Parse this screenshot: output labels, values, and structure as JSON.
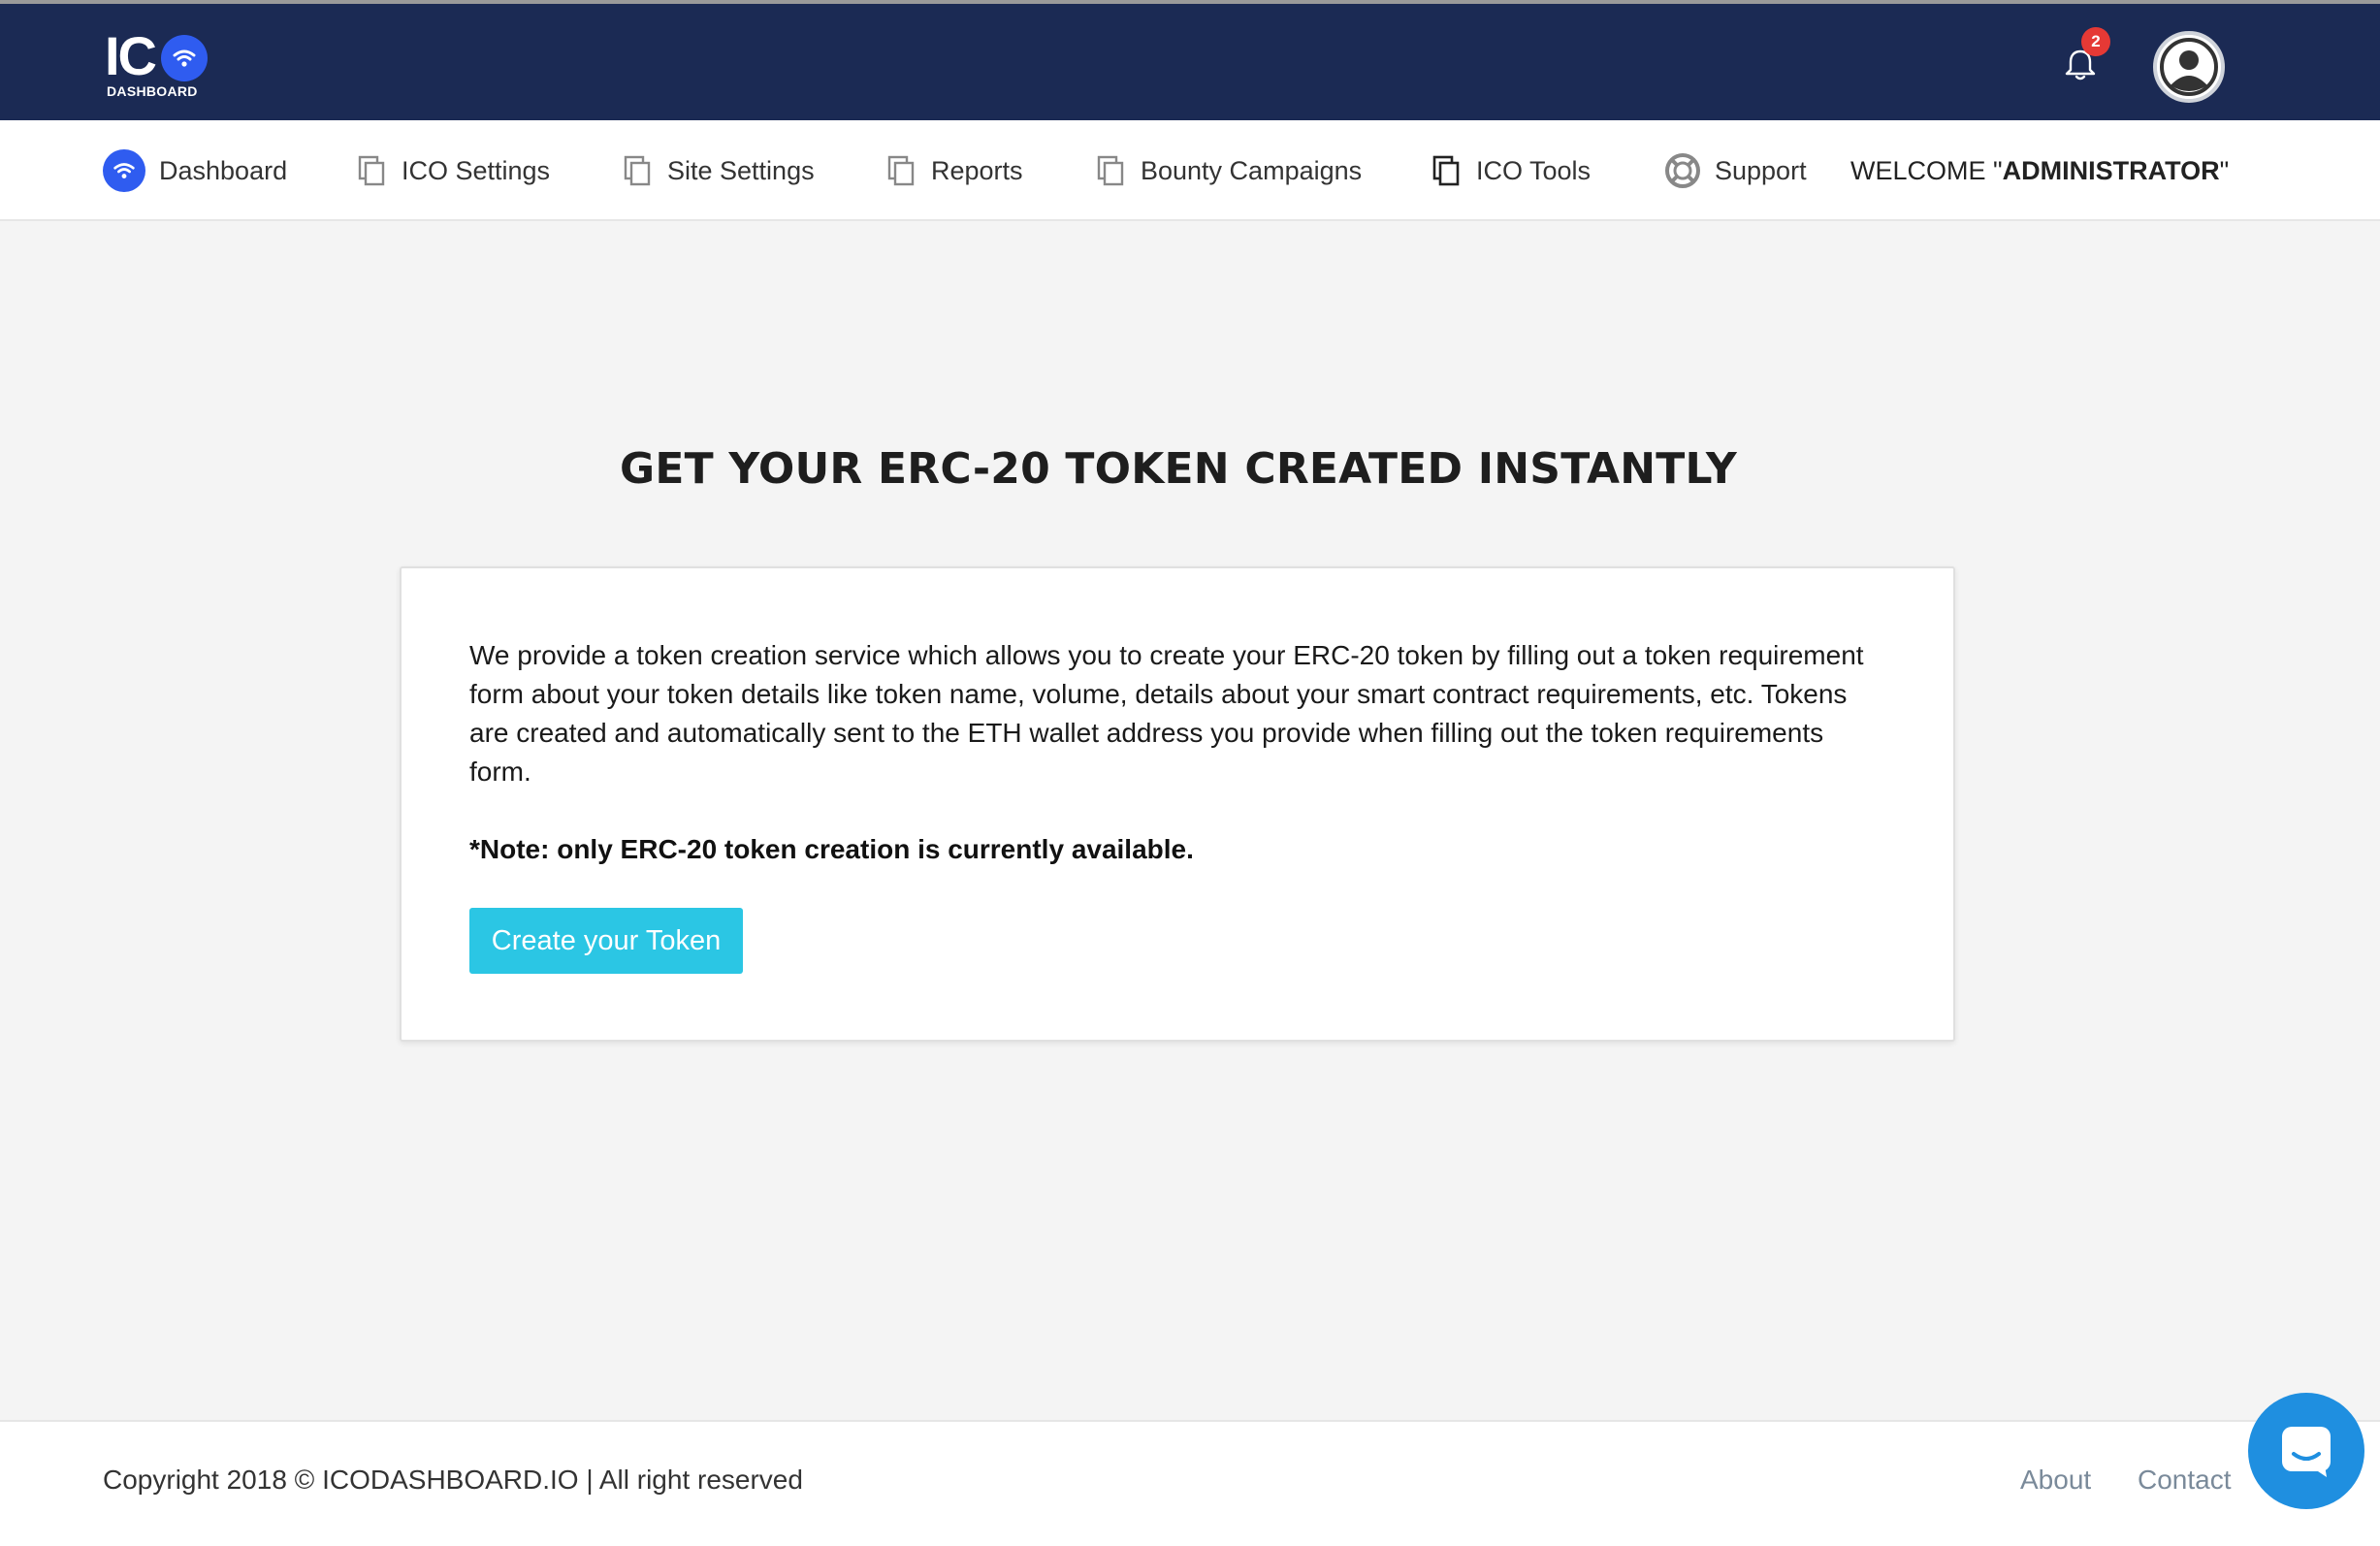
{
  "header": {
    "logo_main": "IC",
    "logo_sub": "DASHBOARD",
    "notification_count": "2",
    "brand_color": "#1b2a54",
    "accent_color": "#2f5cf0"
  },
  "nav": {
    "items": [
      {
        "label": "Dashboard",
        "icon": "wifi-logo-icon"
      },
      {
        "label": "ICO Settings",
        "icon": "copy-icon"
      },
      {
        "label": "Site Settings",
        "icon": "copy-icon"
      },
      {
        "label": "Reports",
        "icon": "copy-icon"
      },
      {
        "label": "Bounty Campaigns",
        "icon": "copy-icon"
      },
      {
        "label": "ICO Tools",
        "icon": "copy-icon"
      },
      {
        "label": "Support",
        "icon": "lifebuoy-icon"
      }
    ],
    "welcome_prefix": "WELCOME \"",
    "welcome_user": "ADMINISTRATOR",
    "welcome_suffix": " \""
  },
  "main": {
    "heading": "GET YOUR ERC-20 TOKEN CREATED INSTANTLY",
    "description": "We provide a token creation service which allows you to create your ERC-20 token by filling out a token requirement form about your token details like token name, volume, details about your smart contract requirements, etc. Tokens are created and automatically sent to the ETH wallet address you provide when filling out the token requirements form.",
    "note": "*Note: only ERC-20 token creation is currently available.",
    "create_button": "Create your Token",
    "button_color": "#2bc6e4"
  },
  "footer": {
    "copyright": "Copyright 2018 © ICODASHBOARD.IO | All right reserved",
    "about": "About",
    "contact": "Contact"
  }
}
